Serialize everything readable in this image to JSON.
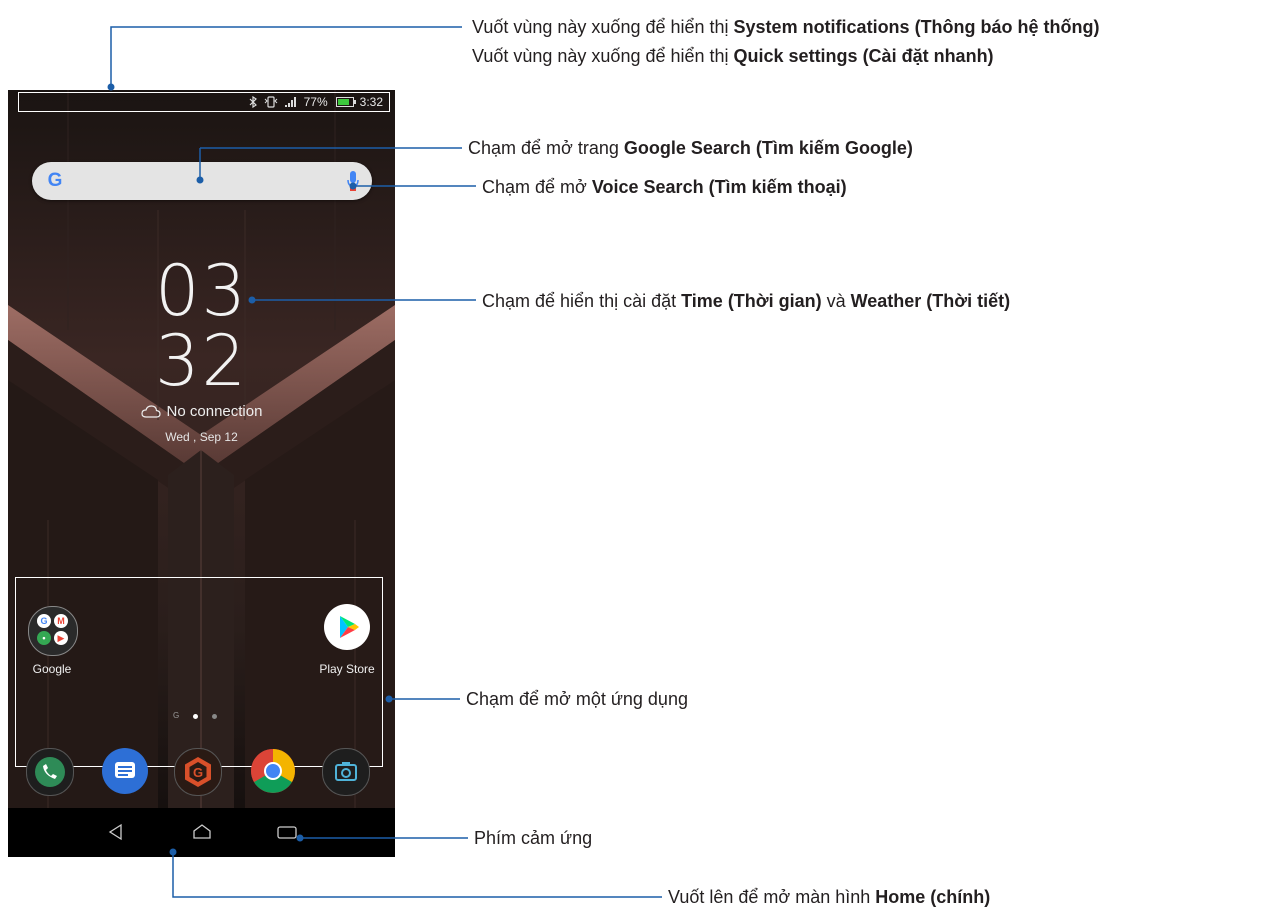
{
  "status_bar": {
    "battery": "77%",
    "time": "3:32"
  },
  "search": {
    "logo": "G"
  },
  "clock": {
    "hours": "03",
    "minutes": "32",
    "weather": "No connection",
    "date": "Wed , Sep 12"
  },
  "apps": {
    "google_label": "Google",
    "playstore_label": "Play Store"
  },
  "icons": {
    "bluetooth": "bluetooth-icon",
    "vibrate": "vibrate-icon",
    "signal": "signal-icon",
    "battery": "battery-icon",
    "mic": "mic-icon",
    "cloud": "cloud-icon",
    "phone": "phone-icon",
    "messages": "messages-icon",
    "game": "game-center-icon",
    "chrome": "chrome-icon",
    "camera": "camera-icon",
    "back": "back-icon",
    "home": "home-icon",
    "recents": "recents-icon"
  },
  "callouts": {
    "notifications": {
      "prefix": "Vuốt vùng này xuống để hiển thị ",
      "bold": "System notifications (Thông báo hệ thống)"
    },
    "quick_settings": {
      "prefix": "Vuốt vùng này xuống để hiển thị ",
      "bold": "Quick settings (Cài đặt nhanh)"
    },
    "google_search": {
      "prefix": "Chạm để mở trang ",
      "bold": "Google Search (Tìm kiếm Google)"
    },
    "voice_search": {
      "prefix": "Chạm để mở ",
      "bold": "Voice Search (Tìm kiếm thoại)"
    },
    "time_weather": {
      "prefix": "Chạm để hiển thị cài đặt ",
      "bold1": "Time (Thời gian)",
      "middle": " và ",
      "bold2": "Weather (Thời tiết)"
    },
    "open_app": {
      "text": "Chạm để mở một ứng dụng"
    },
    "touch_keys": {
      "text": "Phím cảm ứng"
    },
    "home": {
      "prefix": "Vuốt lên để mở màn hình ",
      "bold": "Home (chính)"
    }
  },
  "colors": {
    "callout_line": "#1c5ea8",
    "text": "#231f20",
    "wallpaper_accent": "#8a5a55"
  }
}
